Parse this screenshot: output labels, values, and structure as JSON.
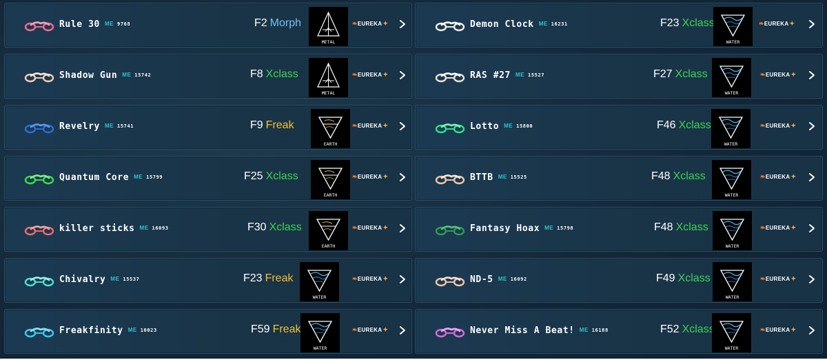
{
  "colors": {
    "me": "#2ec4c9",
    "morph": "#6fc3f0",
    "xclass": "#39d353",
    "freak": "#f2c12e"
  },
  "labels": {
    "me": "ME",
    "eureka": "EUREKA",
    "chevron_icon": "chevron-right-icon",
    "bike_icon": "motorbike-icon",
    "eureka_icon": "flame-icon"
  },
  "left": [
    {
      "name": "Rule 30",
      "number": "9768",
      "rank": "F2",
      "class": "Morph",
      "class_key": "morph",
      "element": "METAL",
      "bike_color": "#f26b8a",
      "bike_color2": "#ff9fc0"
    },
    {
      "name": "Shadow Gun",
      "number": "15742",
      "rank": "F8",
      "class": "Xclass",
      "class_key": "xclass",
      "element": "METAL",
      "bike_color": "#f3c9b2",
      "bike_color2": "#fbe5d8"
    },
    {
      "name": "Revelry",
      "number": "15741",
      "rank": "F9",
      "class": "Freak",
      "class_key": "freak",
      "element": "EARTH",
      "bike_color": "#2e6cd6",
      "bike_color2": "#5a9bf0"
    },
    {
      "name": "Quantum Core",
      "number": "15799",
      "rank": "F25",
      "class": "Xclass",
      "class_key": "xclass",
      "element": "EARTH",
      "bike_color": "#3ddc4a",
      "bike_color2": "#7cf08a"
    },
    {
      "name": "killer sticks",
      "number": "16093",
      "rank": "F30",
      "class": "Xclass",
      "class_key": "xclass",
      "element": "EARTH",
      "bike_color": "#ef6b6b",
      "bike_color2": "#ffa2a2"
    },
    {
      "name": "Chivalry",
      "number": "15537",
      "rank": "F23",
      "class": "Freak",
      "class_key": "freak",
      "element": "WATER",
      "bike_color": "#4fe0cf",
      "bike_color2": "#9af5ea"
    },
    {
      "name": "Freakfinity",
      "number": "10023",
      "rank": "F59",
      "class": "Freak",
      "class_key": "freak",
      "element": "WATER",
      "bike_color": "#3ec9e9",
      "bike_color2": "#8ae8fa"
    }
  ],
  "right": [
    {
      "name": "Demon Clock",
      "number": "16231",
      "rank": "F23",
      "class": "Xclass",
      "class_key": "xclass",
      "element": "WATER",
      "bike_color": "#f2efe8",
      "bike_color2": "#ffffff"
    },
    {
      "name": "RAS #27",
      "number": "15527",
      "rank": "F27",
      "class": "Xclass",
      "class_key": "xclass",
      "element": "WATER",
      "bike_color": "#ece3d4",
      "bike_color2": "#ffffff"
    },
    {
      "name": "Lotto",
      "number": "15800",
      "rank": "F46",
      "class": "Xclass",
      "class_key": "xclass",
      "element": "WATER",
      "bike_color": "#2fe08a",
      "bike_color2": "#7ef5b8"
    },
    {
      "name": "BTTB",
      "number": "15525",
      "rank": "F48",
      "class": "Xclass",
      "class_key": "xclass",
      "element": "WATER",
      "bike_color": "#f0c7a8",
      "bike_color2": "#fde3cf"
    },
    {
      "name": "Fantasy Hoax",
      "number": "15798",
      "rank": "F48",
      "class": "Xclass",
      "class_key": "xclass",
      "element": "WATER",
      "bike_color": "#2f9a55",
      "bike_color2": "#55c47c"
    },
    {
      "name": "ND-5",
      "number": "16092",
      "rank": "F49",
      "class": "Xclass",
      "class_key": "xclass",
      "element": "WATER",
      "bike_color": "#f2c4a8",
      "bike_color2": "#fde0cf"
    },
    {
      "name": "Never Miss A Beat!",
      "number": "16188",
      "rank": "F52",
      "class": "Xclass",
      "class_key": "xclass",
      "element": "WATER",
      "bike_color": "#d96ad9",
      "bike_color2": "#f5a8f5"
    }
  ]
}
